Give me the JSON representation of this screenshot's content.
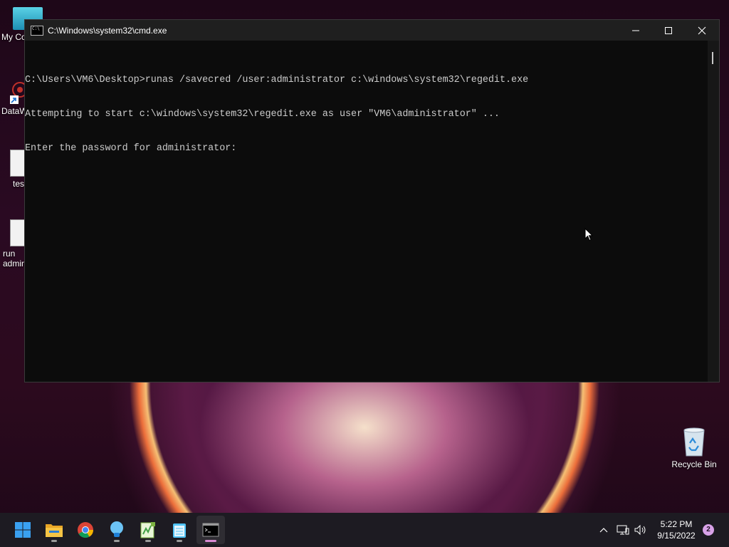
{
  "window": {
    "title": "C:\\Windows\\system32\\cmd.exe",
    "console_lines": [
      "C:\\Users\\VM6\\Desktop>runas /savecred /user:administrator c:\\windows\\system32\\regedit.exe",
      "Attempting to start c:\\windows\\system32\\regedit.exe as user \"VM6\\administrator\" ...",
      "Enter the password for administrator:"
    ]
  },
  "desktop_icons": [
    {
      "label": "My Co",
      "icon": "computer-icon"
    },
    {
      "label": "DataW",
      "icon": "datawrapper-shortcut-icon"
    },
    {
      "label": "tes",
      "icon": "file-icon"
    },
    {
      "label": "run\nadmin",
      "icon": "file-icon"
    },
    {
      "label": "Recycle Bin",
      "icon": "recycle-bin-icon"
    }
  ],
  "taskbar": {
    "apps": [
      "start-icon",
      "file-explorer-icon",
      "chrome-icon",
      "tips-icon",
      "notepad-plus-icon",
      "notepad-icon",
      "cmd-icon"
    ],
    "clock_time": "5:22 PM",
    "clock_date": "9/15/2022",
    "notification_count": "2"
  }
}
